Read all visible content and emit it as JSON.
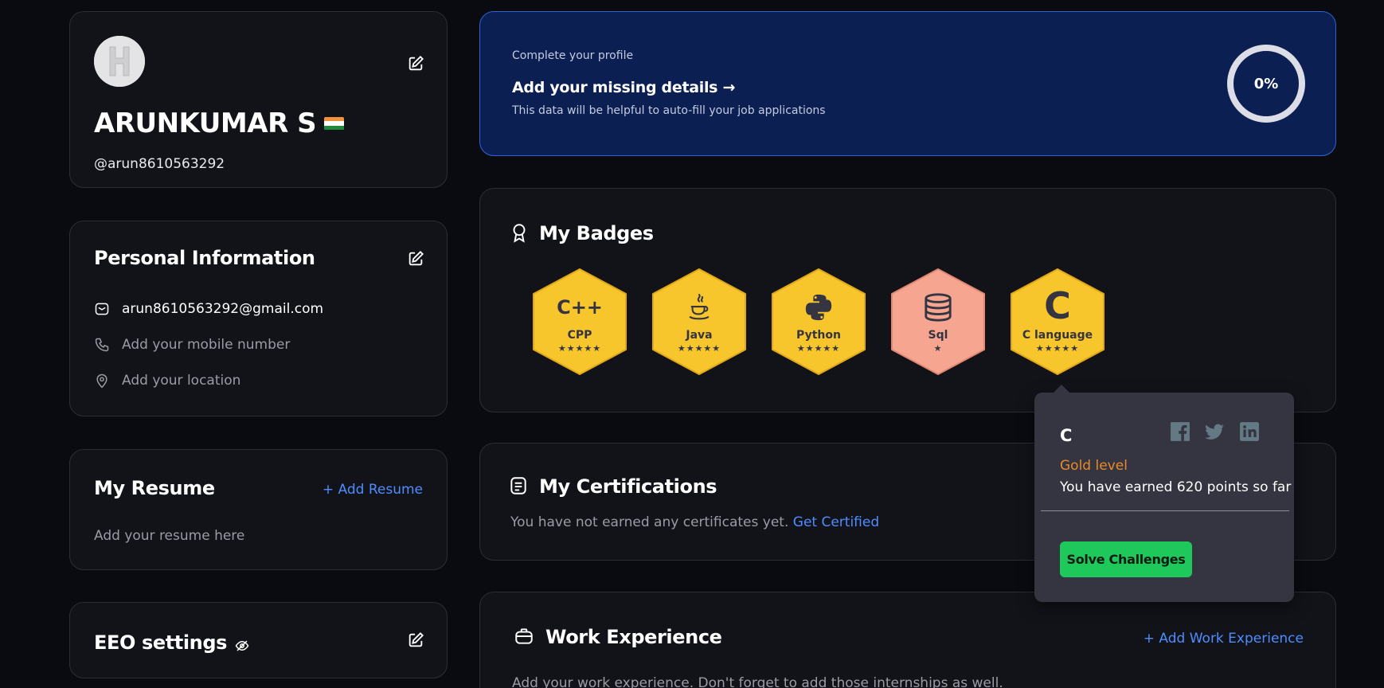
{
  "profile": {
    "name": "ARUNKUMAR S",
    "handle": "@arun8610563292",
    "avatar_letter": "H"
  },
  "personal_info": {
    "title": "Personal Information",
    "email": "arun8610563292@gmail.com",
    "mobile_placeholder": "Add your mobile number",
    "location_placeholder": "Add your location"
  },
  "resume": {
    "title": "My Resume",
    "add_label": "+ Add Resume",
    "placeholder": "Add your resume here"
  },
  "eeo": {
    "title": "EEO settings"
  },
  "complete_profile": {
    "eyebrow": "Complete your profile",
    "heading": "Add your missing details",
    "arrow": "→",
    "subtext": "This data will be helpful to auto-fill your job applications",
    "progress_label": "0%",
    "progress_fraction": 0
  },
  "badges": {
    "title": "My Badges",
    "items": [
      {
        "name": "CPP",
        "glyph": "C++",
        "stars": "★★★★★",
        "level": "gold"
      },
      {
        "name": "Java",
        "glyph": "java-icon",
        "stars": "★★★★★",
        "level": "gold"
      },
      {
        "name": "Python",
        "glyph": "python-icon",
        "stars": "★★★★★",
        "level": "gold"
      },
      {
        "name": "Sql",
        "glyph": "database-icon",
        "stars": "★",
        "level": "bronze"
      },
      {
        "name": "C language",
        "glyph": "C",
        "stars": "★★★★★",
        "level": "gold"
      }
    ]
  },
  "certifications": {
    "title": "My Certifications",
    "empty_text": "You have not earned any certificates yet.",
    "cta": "Get Certified"
  },
  "work_experience": {
    "title": "Work Experience",
    "add_label": "+ Add Work Experience",
    "placeholder": "Add your work experience. Don't forget to add those internships as well."
  },
  "popover": {
    "title": "C",
    "level": "Gold level",
    "points_text": "You have earned 620 points so far",
    "button": "Solve Challenges"
  },
  "colors": {
    "background": "#0a0b10",
    "card": "#121319",
    "banner": "#0b1f52",
    "link": "#4d8dff",
    "gold": "#f7c52c",
    "bronze": "#f6a08c",
    "green": "#1fc85a",
    "level_orange": "#e88a2a"
  }
}
